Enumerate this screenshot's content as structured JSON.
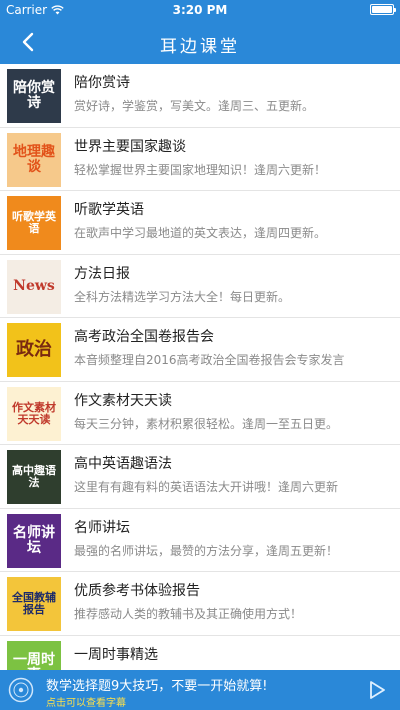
{
  "status_bar": {
    "carrier": "Carrier",
    "time": "3:20 PM",
    "wifi_icon": "wifi-icon",
    "battery_icon": "battery-icon"
  },
  "nav": {
    "title": "耳边课堂",
    "back_icon": "chevron-left-icon"
  },
  "courses": [
    {
      "name": "陪你赏诗",
      "desc": "赏好诗，学鉴赏，写美文。逢周三、五更新。",
      "thumb_text": "陪你赏诗",
      "thumb_bg": "#2e3a4a",
      "thumb_fg": "#ffffff"
    },
    {
      "name": "世界主要国家趣谈",
      "desc": "轻松掌握世界主要国家地理知识！逢周六更新！",
      "thumb_text": "地理趣谈",
      "thumb_bg": "#f6c98b",
      "thumb_fg": "#e2531a"
    },
    {
      "name": "听歌学英语",
      "desc": "在歌声中学习最地道的英文表达，逢周四更新。",
      "thumb_text": "听歌学英语",
      "thumb_bg": "#f08a1c",
      "thumb_fg": "#ffffff"
    },
    {
      "name": "方法日报",
      "desc": "全科方法精选学习方法大全！每日更新。",
      "thumb_text": "News",
      "thumb_bg": "#f4ede4",
      "thumb_fg": "#c0392b"
    },
    {
      "name": "高考政治全国卷报告会",
      "desc": "本音频整理自2016高考政治全国卷报告会专家发言",
      "thumb_text": "政治",
      "thumb_bg": "#f2c21a",
      "thumb_fg": "#7a2a10"
    },
    {
      "name": "作文素材天天读",
      "desc": "每天三分钟，素材积累很轻松。逢周一至五日更。",
      "thumb_text": "作文素材天天读",
      "thumb_bg": "#fdf1d2",
      "thumb_fg": "#c0392b"
    },
    {
      "name": "高中英语趣语法",
      "desc": "这里有有趣有料的英语语法大开讲哦！逢周六更新",
      "thumb_text": "高中趣语法",
      "thumb_bg": "#2f3e2e",
      "thumb_fg": "#ffffff"
    },
    {
      "name": "名师讲坛",
      "desc": "最强的名师讲坛，最赞的方法分享，逢周五更新！",
      "thumb_text": "名师讲坛",
      "thumb_bg": "#5a2a86",
      "thumb_fg": "#ffffff"
    },
    {
      "name": "优质参考书体验报告",
      "desc": "推荐感动人类的教辅书及其正确使用方式！",
      "thumb_text": "全国教辅报告",
      "thumb_bg": "#f3c53a",
      "thumb_fg": "#1c2a6a"
    },
    {
      "name": "一周时事精选",
      "desc": "",
      "thumb_text": "一周时事",
      "thumb_bg": "#7cc242",
      "thumb_fg": "#ffffff"
    }
  ],
  "player": {
    "title": "数学选择题9大技巧，不要一开始就算!",
    "hint": "点击可以查看字幕",
    "disc_icon": "disc-icon",
    "play_icon": "play-icon",
    "accent": "#2a88d8",
    "hint_color": "#ffe14a"
  }
}
